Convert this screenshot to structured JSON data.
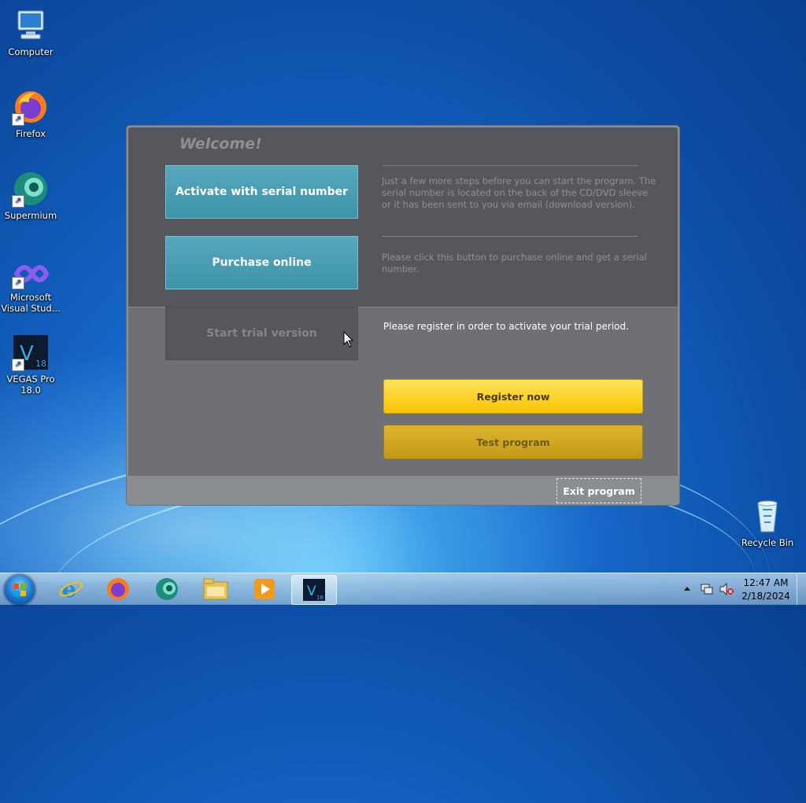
{
  "desktop": {
    "icons": [
      {
        "label": "Computer",
        "icon": "computer-icon"
      },
      {
        "label": "Firefox",
        "icon": "firefox-icon"
      },
      {
        "label": "Supermium",
        "icon": "supermium-icon"
      },
      {
        "label": "Microsoft Visual Stud...",
        "icon": "visual-studio-icon"
      },
      {
        "label": "VEGAS Pro 18.0",
        "icon": "vegas-pro-icon"
      },
      {
        "label": "Recycle Bin",
        "icon": "recycle-bin-icon"
      }
    ]
  },
  "dialog": {
    "welcome": "Welcome!",
    "activate_label": "Activate with serial number",
    "activate_desc": "Just a few more steps before you can start the program. The serial number is located on the back of the CD/DVD sleeve or it has been sent to you via email (download version).",
    "purchase_label": "Purchase online",
    "purchase_desc": "Please click this button to purchase online and get a serial number.",
    "trial_label": "Start trial version",
    "trial_desc": "Please register in order to activate your trial period.",
    "register_label": "Register now",
    "test_label": "Test program",
    "exit_label": "Exit program"
  },
  "taskbar": {
    "apps": [
      "internet-explorer-icon",
      "firefox-icon",
      "supermium-icon",
      "file-explorer-icon",
      "media-player-icon",
      "vegas-pro-icon"
    ],
    "active_app": "vegas-pro-icon",
    "clock_time": "12:47 AM",
    "clock_date": "2/18/2024"
  },
  "colors": {
    "teal_button": "#4a9db3",
    "yellow_button": "#f8cc10",
    "dialog_dark": "#55575c"
  }
}
